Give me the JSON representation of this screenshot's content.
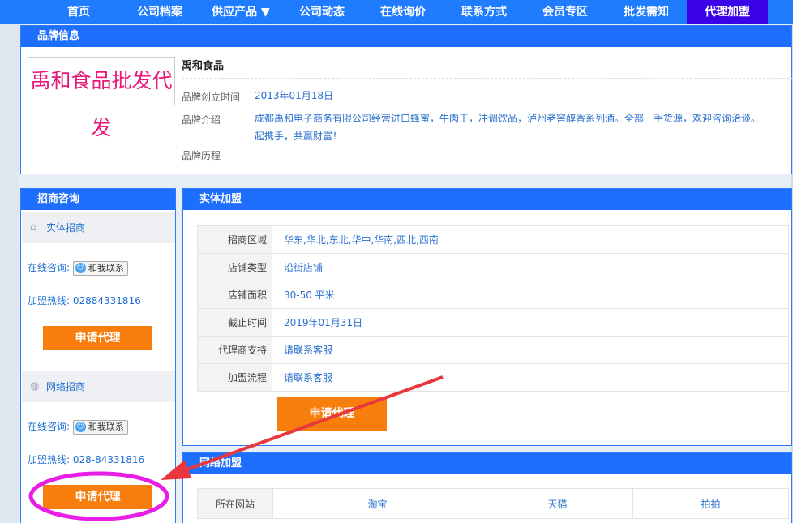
{
  "nav": {
    "items": [
      "首页",
      "公司档案",
      "供应产品 ▼",
      "公司动态",
      "在线询价",
      "联系方式",
      "会员专区",
      "批发需知",
      "代理加盟"
    ],
    "active_index": 8
  },
  "brand": {
    "header": "品牌信息",
    "logo_text": "禹和食品批发代发",
    "name": "禹和食品",
    "founded_label": "品牌创立时间",
    "founded_value": "2013年01月18日",
    "intro_label": "品牌介绍",
    "intro_value": "成都禹和电子商务有限公司经营进口蜂蜜，牛肉干，冲调饮品，泸州老窖醇香系列酒。全部一手货源，欢迎咨询洽谈。一起携手，共赢财富！",
    "history_label": "品牌历程"
  },
  "side": {
    "header": "招商咨询",
    "physical": {
      "title": "实体招商",
      "online_label": "在线咨询:",
      "contact_btn": "和我联系",
      "hotline": "加盟热线: 02884331816",
      "apply": "申请代理"
    },
    "network": {
      "title": "网络招商",
      "online_label": "在线咨询:",
      "contact_btn": "和我联系",
      "hotline": "加盟热线: 028-84331816",
      "apply": "申请代理"
    }
  },
  "physical_join": {
    "header": "实体加盟",
    "rows": [
      {
        "label": "招商区域",
        "value": "华东,华北,东北,华中,华南,西北,西南"
      },
      {
        "label": "店铺类型",
        "value": "沿街店铺"
      },
      {
        "label": "店铺面积",
        "value": "30-50 平米"
      },
      {
        "label": "截止时间",
        "value": "2019年01月31日"
      },
      {
        "label": "代理商支持",
        "value": "请联系客服"
      },
      {
        "label": "加盟流程",
        "value": "请联系客服"
      }
    ],
    "apply": "申请代理"
  },
  "network_join": {
    "header": "网络加盟",
    "site_label": "所在网站",
    "sites": [
      "淘宝",
      "天猫",
      "拍拍"
    ]
  },
  "colors": {
    "nav_bg": "#1f7cff",
    "nav_active": "#3a00e6",
    "apply_btn": "#f77d0c",
    "annotation_arrow": "#e8383d",
    "annotation_circle": "#e81ee6"
  }
}
